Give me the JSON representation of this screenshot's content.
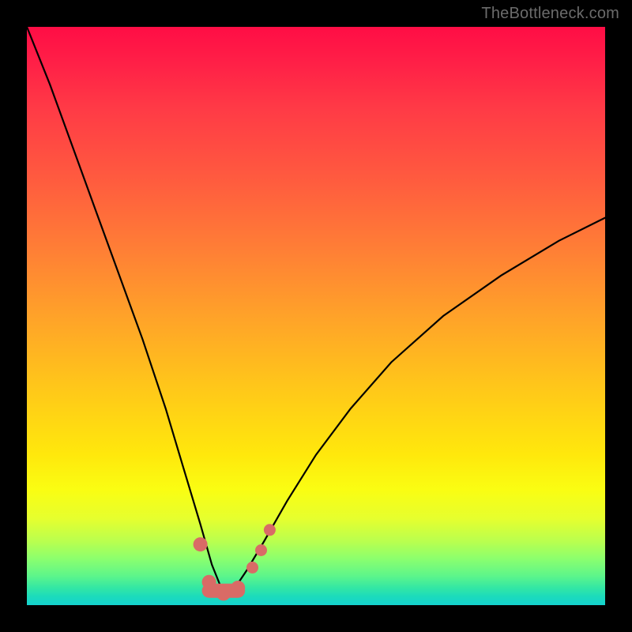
{
  "watermark": "TheBottleneck.com",
  "colors": {
    "page_bg": "#000000",
    "watermark": "#6b6b6b",
    "curve": "#000000",
    "markers": "#d96b66"
  },
  "chart_data": {
    "type": "line",
    "title": "",
    "xlabel": "",
    "ylabel": "",
    "xlim": [
      0,
      100
    ],
    "ylim": [
      0,
      100
    ],
    "grid": false,
    "legend": null,
    "description": "Bottleneck-style curve: a single black V/parabolic curve on a vertical rainbow gradient background. The curve's minimum (near-zero bottleneck) occurs around x≈34 where the curve dips to the green band at the bottom. No axes, ticks, or labels are rendered in the image.",
    "series": [
      {
        "name": "curve",
        "x": [
          0,
          4,
          8,
          12,
          16,
          20,
          24,
          27,
          30,
          32,
          34,
          36,
          38,
          41,
          45,
          50,
          56,
          63,
          72,
          82,
          92,
          100
        ],
        "y": [
          100,
          90,
          79,
          68,
          57,
          46,
          34,
          24,
          14,
          7,
          2,
          3,
          6,
          11,
          18,
          26,
          34,
          42,
          50,
          57,
          63,
          67
        ]
      }
    ],
    "markers": {
      "name": "highlight_dots",
      "color": "#d96b66",
      "points": [
        {
          "x": 30.0,
          "y": 10.5,
          "size": "lg"
        },
        {
          "x": 31.5,
          "y": 4.0,
          "size": "lg"
        },
        {
          "x": 34.0,
          "y": 2.0,
          "size": "lg"
        },
        {
          "x": 36.5,
          "y": 3.0,
          "size": "lg"
        },
        {
          "x": 39.0,
          "y": 6.5,
          "size": "md"
        },
        {
          "x": 40.5,
          "y": 9.5,
          "size": "md"
        },
        {
          "x": 42.0,
          "y": 13.0,
          "size": "md"
        }
      ],
      "bottom_bar": {
        "x0": 31.5,
        "x1": 36.5,
        "y": 2.5
      }
    }
  }
}
